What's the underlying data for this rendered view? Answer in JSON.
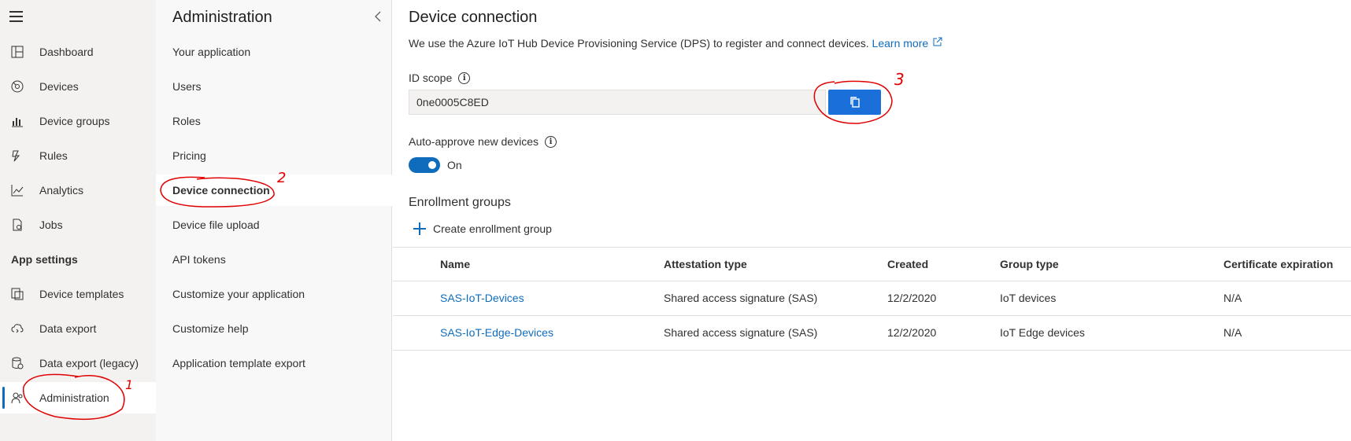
{
  "leftnav": {
    "items": [
      {
        "label": "Dashboard",
        "icon": "dashboard-icon"
      },
      {
        "label": "Devices",
        "icon": "devices-icon"
      },
      {
        "label": "Device groups",
        "icon": "device-groups-icon"
      },
      {
        "label": "Rules",
        "icon": "rules-icon"
      },
      {
        "label": "Analytics",
        "icon": "analytics-icon"
      },
      {
        "label": "Jobs",
        "icon": "jobs-icon"
      }
    ],
    "section_label": "App settings",
    "settings_items": [
      {
        "label": "Device templates",
        "icon": "device-templates-icon"
      },
      {
        "label": "Data export",
        "icon": "data-export-icon"
      },
      {
        "label": "Data export (legacy)",
        "icon": "data-export-legacy-icon"
      },
      {
        "label": "Administration",
        "icon": "administration-icon"
      }
    ]
  },
  "admin": {
    "title": "Administration",
    "items": [
      {
        "label": "Your application"
      },
      {
        "label": "Users"
      },
      {
        "label": "Roles"
      },
      {
        "label": "Pricing"
      },
      {
        "label": "Device connection"
      },
      {
        "label": "Device file upload"
      },
      {
        "label": "API tokens"
      },
      {
        "label": "Customize your application"
      },
      {
        "label": "Customize help"
      },
      {
        "label": "Application template export"
      }
    ]
  },
  "main": {
    "title": "Device connection",
    "description": "We use the Azure IoT Hub Device Provisioning Service (DPS) to register and connect devices.",
    "learn_more": "Learn more",
    "id_scope_label": "ID scope",
    "id_scope_value": "0ne0005C8ED",
    "auto_approve_label": "Auto-approve new devices",
    "toggle_label": "On",
    "enrollment_title": "Enrollment groups",
    "create_label": "Create enrollment group",
    "columns": [
      "Name",
      "Attestation type",
      "Created",
      "Group type",
      "Certificate expiration"
    ],
    "rows": [
      [
        "SAS-IoT-Devices",
        "Shared access signature (SAS)",
        "12/2/2020",
        "IoT devices",
        "N/A"
      ],
      [
        "SAS-IoT-Edge-Devices",
        "Shared access signature (SAS)",
        "12/2/2020",
        "IoT Edge devices",
        "N/A"
      ]
    ]
  },
  "annotations": {
    "step1": "1",
    "step2": "2",
    "step3": "3"
  },
  "colors": {
    "accent": "#0f6cbd",
    "button": "#1b6fd8",
    "annotation": "#e00000"
  }
}
